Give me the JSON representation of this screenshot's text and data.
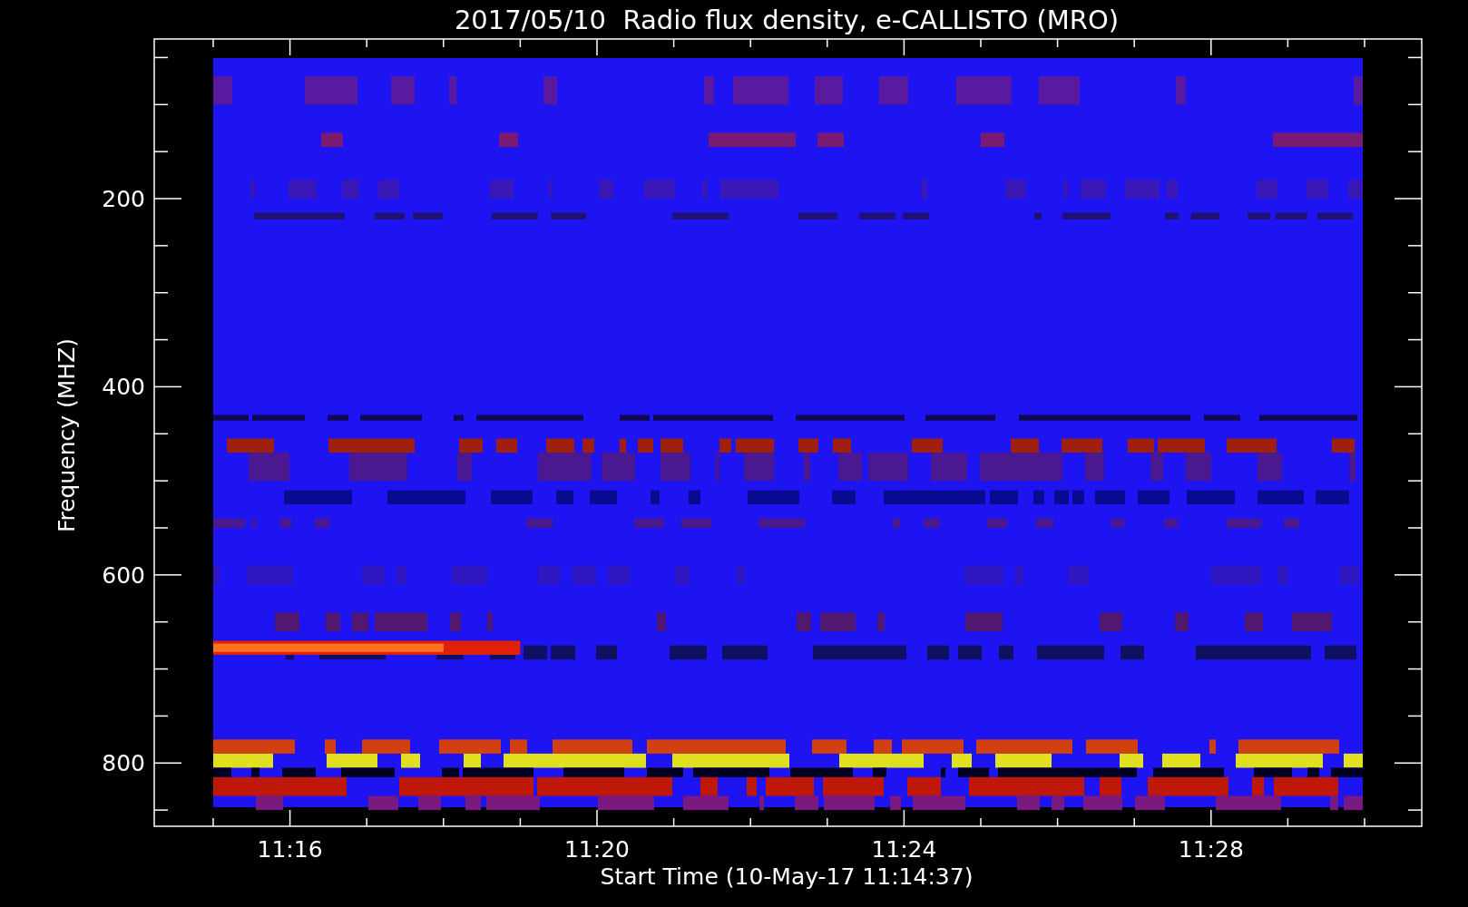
{
  "plot": {
    "title": "2017/05/10  Radio flux density, e-CALLISTO (MRO)",
    "xlabel": "Start Time (10-May-17 11:14:37)",
    "ylabel": "Frequency (MHZ)",
    "xticks": [
      "11:16",
      "11:20",
      "11:24",
      "11:28"
    ],
    "yticks": [
      "200",
      "400",
      "600",
      "800"
    ]
  }
}
